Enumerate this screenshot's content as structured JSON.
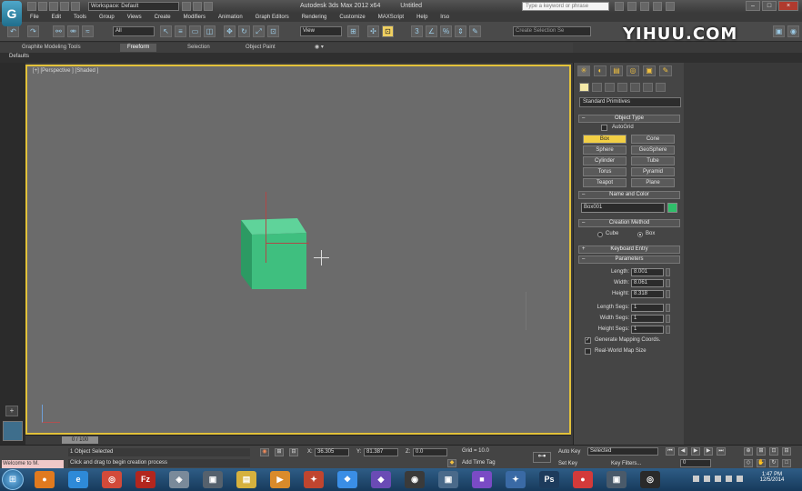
{
  "title_bar": {
    "logo": "3ds-max-logo",
    "workspace": "Workspace: Default",
    "app_title": "Autodesk 3ds Max 2012 x64",
    "file_title": "Untitled",
    "search_placeholder": "Type a keyword or phrase"
  },
  "menu": [
    "File",
    "Edit",
    "Tools",
    "Group",
    "Views",
    "Create",
    "Modifiers",
    "Animation",
    "Graph Editors",
    "Rendering",
    "Customize",
    "MAXScript",
    "Help",
    "lrso"
  ],
  "toolbar": {
    "filter_value": "All",
    "ref_coord_value": "View",
    "selection_set_placeholder": "Create Selection Se"
  },
  "watermark": "YIHUU.COM",
  "ribbon_tabs": [
    "Graphite Modeling Tools",
    "Freeform",
    "Selection",
    "Object Paint"
  ],
  "ribbon_extra": "◉ ▾",
  "defaults_label": "Defaults",
  "viewport": {
    "label": "[+] [Perspective ] [Shaded ]",
    "object_color": "#3fbf7f",
    "border_color": "#e3c23a"
  },
  "command_panel": {
    "category": "Standard Primitives",
    "object_type_title": "Object Type",
    "autogrid_label": "AutoGrid",
    "primitives": [
      {
        "label": "Box",
        "active": true
      },
      {
        "label": "Cone",
        "active": false
      },
      {
        "label": "Sphere",
        "active": false
      },
      {
        "label": "GeoSphere",
        "active": false
      },
      {
        "label": "Cylinder",
        "active": false
      },
      {
        "label": "Tube",
        "active": false
      },
      {
        "label": "Torus",
        "active": false
      },
      {
        "label": "Pyramid",
        "active": false
      },
      {
        "label": "Teapot",
        "active": false
      },
      {
        "label": "Plane",
        "active": false
      }
    ],
    "name_color_title": "Name and Color",
    "object_name": "Box001",
    "swatch_color": "#2fbf6a",
    "creation_method_title": "Creation Method",
    "creation_options": [
      {
        "label": "Cube",
        "selected": false
      },
      {
        "label": "Box",
        "selected": true
      }
    ],
    "keyboard_entry_title": "Keyboard Entry",
    "parameters_title": "Parameters",
    "params": [
      {
        "label": "Length:",
        "value": "8.001"
      },
      {
        "label": "Width:",
        "value": "8.061"
      },
      {
        "label": "Height:",
        "value": "8.318"
      }
    ],
    "segs": [
      {
        "label": "Length Segs:",
        "value": "1"
      },
      {
        "label": "Width Segs:",
        "value": "1"
      },
      {
        "label": "Height Segs:",
        "value": "1"
      }
    ],
    "generate_mapping": "Generate Mapping Coords.",
    "real_world": "Real-World Map Size"
  },
  "timeline": {
    "slider": "0 / 100"
  },
  "status": {
    "maxscript": "Welcome to M.",
    "selected": "1 Object Selected",
    "prompt": "Click and drag to begin creation process",
    "x_label": "X:",
    "x_value": "36.305",
    "y_label": "Y:",
    "y_value": "81.387",
    "z_label": "Z:",
    "z_value": "0.0",
    "grid": "Grid = 10.0",
    "add_time_tag": "Add Time Tag",
    "auto_key": "Auto Key",
    "key_mode": "Selected",
    "set_key": "Set Key",
    "key_filters": "Key Filters...",
    "frame": "0"
  },
  "taskbar": {
    "start": "⊞",
    "apps": [
      {
        "name": "firefox",
        "glyph": "●",
        "color": "#e07a1f"
      },
      {
        "name": "internet-explorer",
        "glyph": "e",
        "color": "#2e8ad8"
      },
      {
        "name": "chrome",
        "glyph": "◎",
        "color": "#d24a3a"
      },
      {
        "name": "filezilla",
        "glyph": "Fz",
        "color": "#b3261e"
      },
      {
        "name": "app-5",
        "glyph": "◈",
        "color": "#7a8a9a"
      },
      {
        "name": "app-6",
        "glyph": "▣",
        "color": "#55616d"
      },
      {
        "name": "folder",
        "glyph": "▤",
        "color": "#d6b13e"
      },
      {
        "name": "media-player",
        "glyph": "▶",
        "color": "#d98b2b"
      },
      {
        "name": "app-9",
        "glyph": "✦",
        "color": "#c0452f"
      },
      {
        "name": "dropbox",
        "glyph": "❖",
        "color": "#3a8ee6"
      },
      {
        "name": "app-11",
        "glyph": "◆",
        "color": "#6a4bb5"
      },
      {
        "name": "app-12",
        "glyph": "◉",
        "color": "#3a3a3a"
      },
      {
        "name": "app-13",
        "glyph": "▣",
        "color": "#4a6a8a"
      },
      {
        "name": "app-14",
        "glyph": "■",
        "color": "#7a4bc5"
      },
      {
        "name": "app-15",
        "glyph": "✦",
        "color": "#3a6aa5"
      },
      {
        "name": "photoshop",
        "glyph": "Ps",
        "color": "#1d3b5c"
      },
      {
        "name": "app-17",
        "glyph": "●",
        "color": "#d33a3a"
      },
      {
        "name": "app-18",
        "glyph": "▣",
        "color": "#4a5a6a"
      },
      {
        "name": "app-19",
        "glyph": "◎",
        "color": "#2a2a2a"
      }
    ],
    "time": "1:47 PM",
    "date": "12/5/2014"
  }
}
